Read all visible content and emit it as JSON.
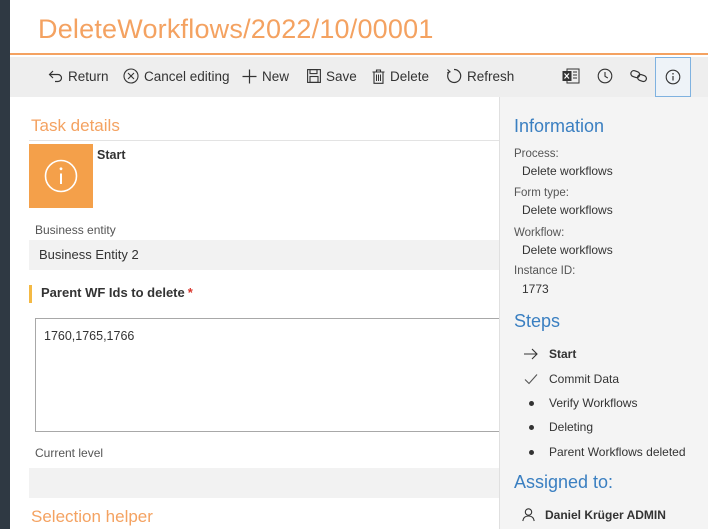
{
  "window": {
    "title": "DeleteWorkflows/2022/10/00001"
  },
  "toolbar": {
    "return_label": "Return",
    "cancel_label": "Cancel editing",
    "new_label": "New",
    "save_label": "Save",
    "delete_label": "Delete",
    "refresh_label": "Refresh",
    "icons": [
      "excel-export-icon",
      "history-clock-icon",
      "link-icon",
      "info-icon"
    ]
  },
  "task": {
    "section_title": "Task details",
    "step_name": "Start",
    "business_entity_label": "Business entity",
    "business_entity_value": "Business Entity 2",
    "parent_ids_label": "Parent WF Ids to delete",
    "required_mark": "*",
    "parent_ids_value": "1760,1765,1766",
    "current_level_label": "Current level",
    "current_level_value": "",
    "selection_helper_title": "Selection helper"
  },
  "info_panel": {
    "information_title": "Information",
    "process_label": "Process:",
    "process_value": "Delete workflows",
    "form_type_label": "Form type:",
    "form_type_value": "Delete workflows",
    "workflow_label": "Workflow:",
    "workflow_value": "Delete workflows",
    "instance_label": "Instance ID:",
    "instance_value": "1773",
    "steps_title": "Steps",
    "steps": [
      {
        "name": "Start",
        "state": "current"
      },
      {
        "name": "Commit Data",
        "state": "done"
      },
      {
        "name": "Verify Workflows",
        "state": "pending"
      },
      {
        "name": "Deleting",
        "state": "pending"
      },
      {
        "name": "Parent Workflows deleted",
        "state": "pending"
      }
    ],
    "assigned_title": "Assigned to:",
    "assignee": "Daniel Krüger ADMIN"
  },
  "colors": {
    "accent_orange": "#f4a261",
    "step_box_orange": "#f4a04a",
    "panel_blue": "#3a7fc1",
    "required_red": "#d9342b",
    "left_strip": "#2f3943"
  }
}
